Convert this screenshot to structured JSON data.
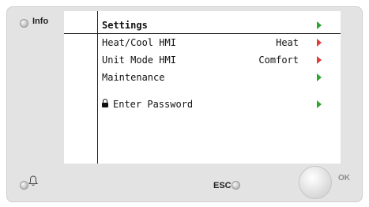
{
  "side": {
    "info_label": "Info"
  },
  "screen": {
    "title": "Settings",
    "items": [
      {
        "label": "Heat/Cool HMI",
        "value": "Heat",
        "arrow": "red"
      },
      {
        "label": "Unit Mode HMI",
        "value": "Comfort",
        "arrow": "red"
      },
      {
        "label": "Maintenance",
        "value": "",
        "arrow": "green"
      },
      {
        "label": "Enter Password",
        "value": "",
        "arrow": "green",
        "icon": "lock-icon"
      }
    ]
  },
  "buttons": {
    "esc_label": "ESC",
    "ok_label": "OK",
    "alarm_icon": "bell-icon"
  },
  "colors": {
    "arrow_green": "#2ea62e",
    "arrow_red": "#e43a3a",
    "panel": "#e3e3e3"
  }
}
